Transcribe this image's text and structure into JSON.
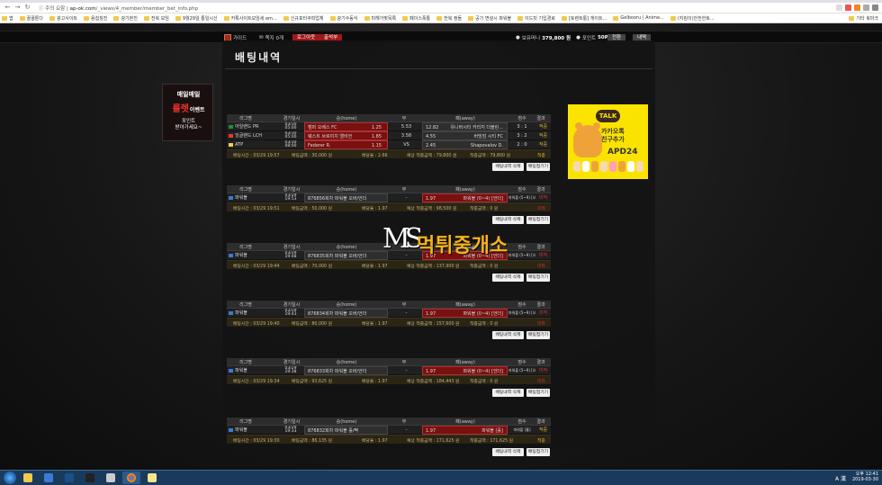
{
  "browser": {
    "insecure_label": "주의 요함",
    "url_host": "ap-ok.com",
    "url_path": "/_views/4_member/member_bet_info.php",
    "bookmarks": [
      "앱",
      "꿀꿀툰다",
      "광고사이트",
      "용쉽징진",
      "광기본진",
      "전복 모임",
      "9월29일 통일시신",
      "카톡사이트모임세 em...",
      "신규포터쿠피업체",
      "광기수동식",
      "피해가맞목록",
      "페이스폭통",
      "전복 정들",
      "공기 변설시 파워볼",
      "이드빗 기입경로",
      "[토렌트통] 게이트...",
      "Gelbooru | Anime...",
      "(지킴이)안전한토..."
    ],
    "bookmarks_other": "기타 북마크"
  },
  "topnav": {
    "items": [
      "가이드",
      "쪽지 0개"
    ],
    "logout": "로그아웃",
    "checkin": "출석부",
    "balance_label": "보유머니",
    "balance_value": "379,800 원",
    "point_label": "포인트",
    "point_value": "50P",
    "convert": "전환",
    "history": "내역"
  },
  "page": {
    "title": "배팅내역"
  },
  "headers": [
    "리그명",
    "경기일시",
    "승(home)",
    "무",
    "패(away)",
    "점수",
    "결과"
  ],
  "buttons": {
    "delete": "배팅내역 삭제",
    "fold": "배팅접기기"
  },
  "bets": [
    {
      "rows": [
        {
          "league": "아일랜드 PR",
          "flag": "ie",
          "date": "03/30",
          "time": "05:00",
          "home": "캠퍼 오베스 FC",
          "hodd": "1.25",
          "draw": "5.53",
          "away": "유니버시티 카리지 더블린...",
          "aodd": "12.82",
          "score": "3 : 1",
          "result": "적중",
          "sel": "home"
        },
        {
          "league": "잉글랜드 LCH",
          "flag": "en",
          "date": "03/30",
          "time": "05:00",
          "home": "웨스트 브로미치 앨비언",
          "hodd": "1.85",
          "draw": "3.58",
          "away": "버밍엄 시티 FC",
          "aodd": "4.55",
          "score": "3 : 2",
          "result": "적중",
          "sel": "home"
        },
        {
          "league": "ATP",
          "flag": "atp",
          "date": "03/30",
          "time": "08:00",
          "home": "Federer R.",
          "hodd": "1.15",
          "draw": "VS",
          "away": "Shapovalov D.",
          "aodd": "2.45",
          "score": "2 : 0",
          "result": "적중",
          "sel": "home"
        }
      ],
      "foot": {
        "time": "배팅시간 : 03/29 19:57",
        "amount": "배팅금액 : 30,000 원",
        "rate": "배당율 : 2.66",
        "expect": "예상 적중금액 : 79,800 원",
        "win": "적중금액 : 79,800 원",
        "res": "적중",
        "res_type": "win"
      }
    },
    {
      "rows": [
        {
          "league": "파워볼",
          "flag": "pb",
          "date": "03/29",
          "time": "19:53",
          "home": "876856회차 파워볼 오버/언더",
          "hodd": "",
          "draw": "-",
          "away": "파워볼 (0~4) [언더]",
          "aodd": "1.97",
          "score": "파워볼 (5~9) [오버]",
          "result": "미적",
          "sel": "away",
          "lose": true
        }
      ],
      "foot": {
        "time": "배팅시간 : 03/29 19:51",
        "amount": "배팅금액 : 50,000 원",
        "rate": "배당율 : 1.97",
        "expect": "예상 적중금액 : 98,500 원",
        "win": "적중금액 : 0 원",
        "res": "미적",
        "res_type": "lose"
      }
    },
    {
      "rows": [
        {
          "league": "파워볼",
          "flag": "pb",
          "date": "03/29",
          "time": "19:48",
          "home": "876835회차 파워볼 오버/언더",
          "hodd": "",
          "draw": "-",
          "away": "파워볼 (0~4) [언더]",
          "aodd": "1.97",
          "score": "파워볼 (5~9) [오버]",
          "result": "미적",
          "sel": "away",
          "lose": true
        }
      ],
      "foot": {
        "time": "배팅시간 : 03/29 19:44",
        "amount": "배팅금액 : 70,000 원",
        "rate": "배당율 : 1.97",
        "expect": "예상 적중금액 : 137,900 원",
        "win": "적중금액 : 0 원",
        "res": "미적",
        "res_type": "lose"
      }
    },
    {
      "rows": [
        {
          "league": "파워볼",
          "flag": "pb",
          "date": "03/29",
          "time": "19:43",
          "home": "876834회차 파워볼 오버/언더",
          "hodd": "",
          "draw": "-",
          "away": "파워볼 (0~4) [언더]",
          "aodd": "1.97",
          "score": "파워볼 (5~9) [오버]",
          "result": "미적",
          "sel": "away",
          "lose": true
        }
      ],
      "foot": {
        "time": "배팅시간 : 03/29 19:40",
        "amount": "배팅금액 : 80,000 원",
        "rate": "배당율 : 1.97",
        "expect": "예상 적중금액 : 157,600 원",
        "win": "적중금액 : 0 원",
        "res": "미적",
        "res_type": "lose"
      }
    },
    {
      "rows": [
        {
          "league": "파워볼",
          "flag": "pb",
          "date": "03/29",
          "time": "19:38",
          "home": "876833회차 파워볼 오버/언더",
          "hodd": "",
          "draw": "-",
          "away": "파워볼 (0~4) [언더]",
          "aodd": "1.97",
          "score": "파워볼 (5~9) [오버]",
          "result": "미적",
          "sel": "away",
          "lose": true
        }
      ],
      "foot": {
        "time": "배팅시간 : 03/29 19:34",
        "amount": "배팅금액 : 93,625 원",
        "rate": "배당율 : 1.97",
        "expect": "예상 적중금액 : 184,443 원",
        "win": "적중금액 : 0 원",
        "res": "미적",
        "res_type": "lose"
      }
    },
    {
      "rows": [
        {
          "league": "파워볼",
          "flag": "pb",
          "date": "03/29",
          "time": "19:33",
          "home": "876832회차 파워볼 홀/짝",
          "hodd": "",
          "draw": "-",
          "away": "파워볼 [홀]",
          "aodd": "1.97",
          "score": "파워볼 [홀]",
          "result": "적중",
          "sel": "away"
        }
      ],
      "foot": {
        "time": "배팅시간 : 03/29 19:30",
        "amount": "배팅금액 : 86,135 원",
        "rate": "배당율 : 1.97",
        "expect": "예상 적중금액 : 171,625 원",
        "win": "적중금액 : 171,625 원",
        "res": "적중",
        "res_type": "win"
      }
    }
  ],
  "left_banner": {
    "line1": "매일매일",
    "line2": "룰렛",
    "line2b": "이벤트",
    "line3": "포인트\n받아가세요~"
  },
  "right_banner": {
    "talk": "TALK",
    "line1": "카카오톡",
    "line2": "친구추가",
    "id": "APD24"
  },
  "watermark": {
    "text": "먹튀중개소"
  },
  "taskbar": {
    "time": "오후 12:41",
    "date": "2019-03-30",
    "ime": "A 漢"
  }
}
